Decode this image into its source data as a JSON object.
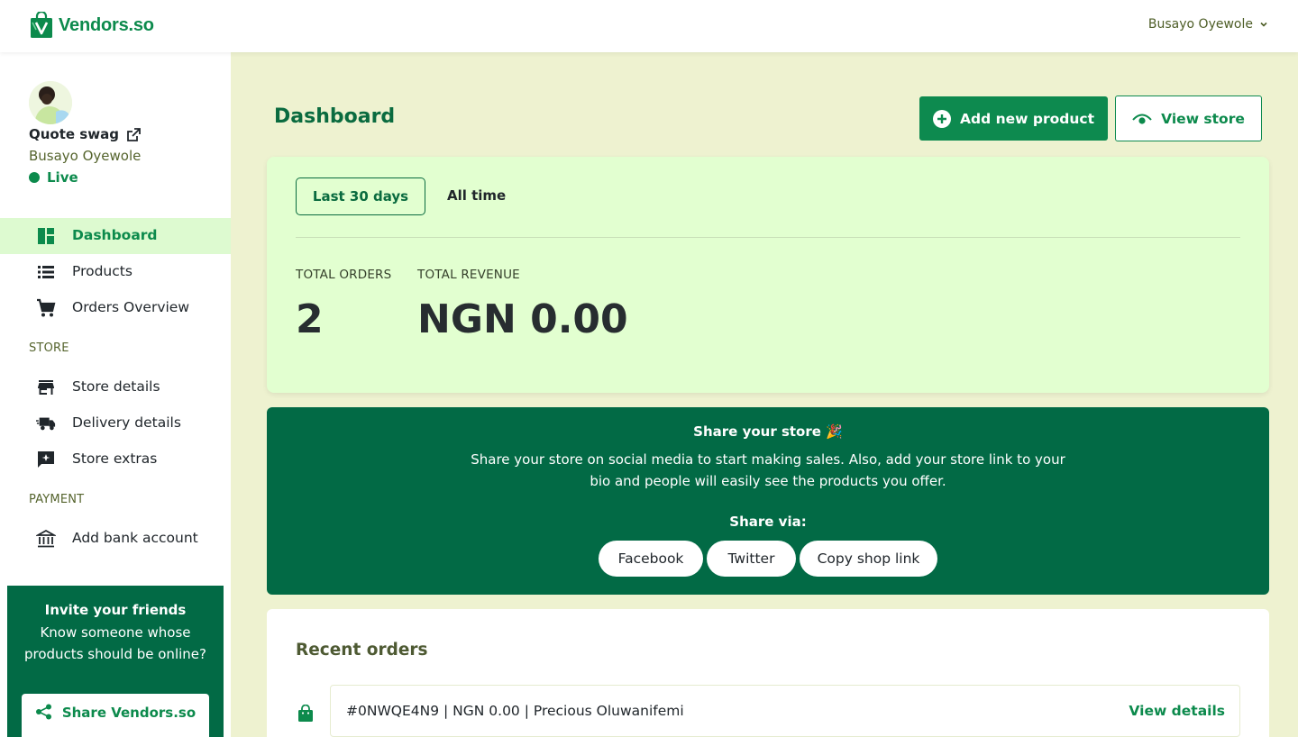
{
  "brand": {
    "name": "Vendors.so",
    "color": "#0c8a4c",
    "dark": "#026a45"
  },
  "header": {
    "user_name": "Busayo Oyewole",
    "menu_icon": "chevron-down-icon"
  },
  "profile": {
    "store_name": "Quote swag",
    "owner": "Busayo Oyewole",
    "status": "Live"
  },
  "nav": {
    "main": [
      {
        "label": "Dashboard",
        "icon": "dashboard-icon",
        "active": true
      },
      {
        "label": "Products",
        "icon": "list-icon"
      },
      {
        "label": "Orders Overview",
        "icon": "cart-icon"
      }
    ],
    "store_label": "STORE",
    "store": [
      {
        "label": "Store details",
        "icon": "storefront-icon"
      },
      {
        "label": "Delivery details",
        "icon": "truck-icon"
      },
      {
        "label": "Store extras",
        "icon": "sparkle-icon"
      }
    ],
    "payment_label": "PAYMENT",
    "payment": [
      {
        "label": "Add bank account",
        "icon": "bank-icon"
      }
    ]
  },
  "invite": {
    "title": "Invite your friends",
    "text": "Know someone whose products should be online?",
    "button": "Share Vendors.so"
  },
  "dashboard": {
    "title": "Dashboard",
    "add_button": "Add new product",
    "view_button": "View store"
  },
  "stats": {
    "tabs": [
      "Last 30 days",
      "All time"
    ],
    "active_tab": "Last 30 days",
    "orders_label": "TOTAL ORDERS",
    "orders_value": "2",
    "revenue_label": "TOTAL REVENUE",
    "revenue_value": "NGN 0.00"
  },
  "share": {
    "title": "Share your store 🎉",
    "description": "Share your store on social media to start making sales. Also, add your store link to your bio and people will easily see the products you offer.",
    "via_label": "Share via:",
    "buttons": [
      "Facebook",
      "Twitter",
      "Copy shop link"
    ]
  },
  "recent": {
    "title": "Recent orders",
    "orders": [
      {
        "text": "#0NWQE4N9 | NGN 0.00 | Precious Oluwanifemi",
        "link": "View details"
      }
    ]
  }
}
